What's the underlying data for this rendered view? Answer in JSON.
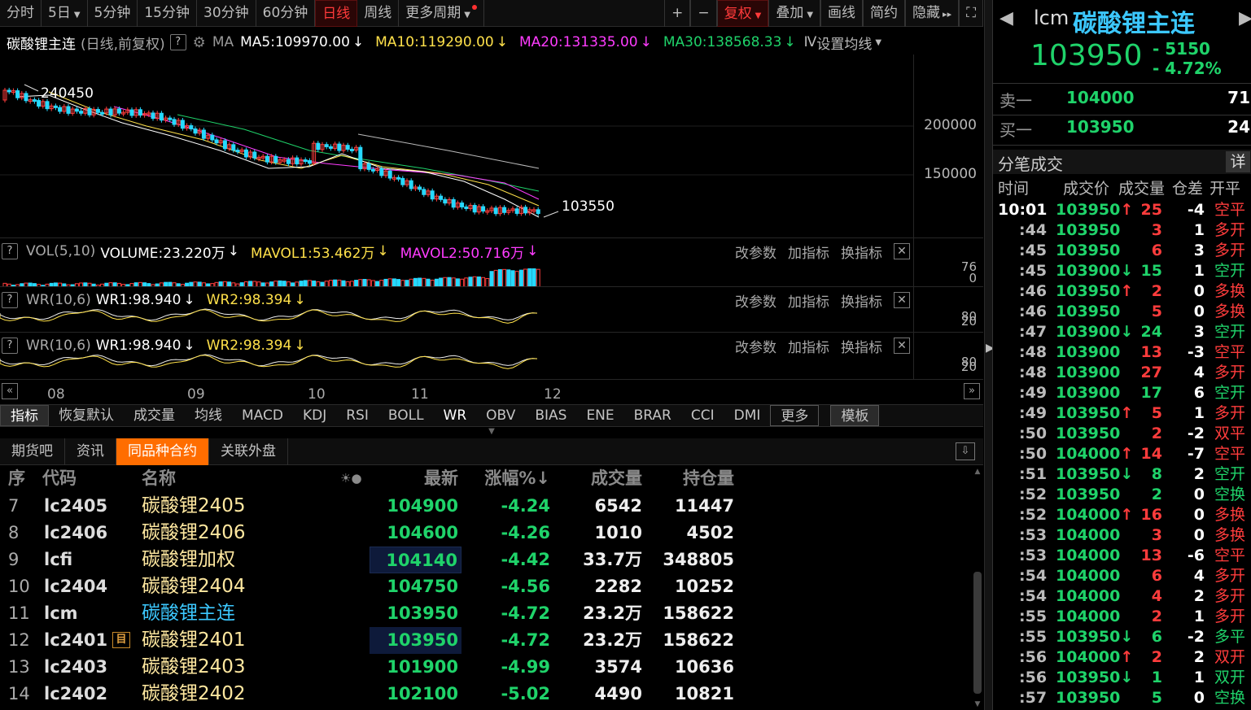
{
  "toolbar": {
    "items": [
      {
        "label": "分时",
        "active": false
      },
      {
        "label": "5日",
        "dd": true
      },
      {
        "label": "5分钟"
      },
      {
        "label": "15分钟"
      },
      {
        "label": "30分钟"
      },
      {
        "label": "60分钟"
      },
      {
        "label": "日线",
        "active": true
      },
      {
        "label": "周线"
      },
      {
        "label": "更多周期",
        "dd": true,
        "dot": true
      }
    ],
    "right": [
      {
        "label": "+"
      },
      {
        "label": "−"
      },
      {
        "label": "复权",
        "dd": true,
        "active": true
      },
      {
        "label": "叠加",
        "dd": true
      },
      {
        "label": "画线"
      },
      {
        "label": "简约"
      },
      {
        "label": "隐藏",
        "arrow": "▸▸"
      },
      {
        "label": "⛶"
      }
    ]
  },
  "ma_info": {
    "name": "碳酸锂主连",
    "mode": "(日线,前复权)",
    "q": "?",
    "ma": "MA",
    "ma5": "MA5:109970.00",
    "ma10": "MA10:119290.00",
    "ma20": "MA20:131335.00",
    "ma30": "MA30:138568.33",
    "ma_more": "Ⅳ",
    "set": "设置均线",
    "arrow": "↓"
  },
  "colors": {
    "up": "#ff3c3c",
    "down": "#26d9ff",
    "ma5": "#ffffff",
    "ma10": "#ffe14a",
    "ma20": "#ff3cff",
    "ma30": "#1fd36a",
    "bg": "#000000",
    "accent": "#ff6d00"
  },
  "main_chart": {
    "high_label": "240450",
    "low_label": "103550",
    "y_ticks": [
      "200000",
      "150000"
    ],
    "x_labels": [
      "08",
      "09",
      "10",
      "11",
      "12"
    ]
  },
  "vol_panel": {
    "q": "?",
    "name": "VOL(5,10)",
    "volume": "VOLUME:23.220万",
    "mavol1": "MAVOL1:53.462万",
    "mavol2": "MAVOL2:50.716万",
    "axis": [
      "76",
      "0"
    ],
    "btn_param": "改参数",
    "btn_add": "加指标",
    "btn_switch": "换指标",
    "close": "✕"
  },
  "wr_panels": [
    {
      "q": "?",
      "name": "WR(10,6)",
      "wr1": "WR1:98.940",
      "wr2": "WR2:98.394",
      "axis": [
        "80",
        "20"
      ],
      "btn_param": "改参数",
      "btn_add": "加指标",
      "btn_switch": "换指标",
      "close": "✕"
    },
    {
      "q": "?",
      "name": "WR(10,6)",
      "wr1": "WR1:98.940",
      "wr2": "WR2:98.394",
      "axis": [
        "80",
        "20"
      ],
      "btn_param": "改参数",
      "btn_add": "加指标",
      "btn_switch": "换指标",
      "close": "✕"
    }
  ],
  "indicator_tabs": [
    "指标",
    "恢复默认",
    "成交量",
    "均线",
    "MACD",
    "KDJ",
    "RSI",
    "BOLL",
    "WR",
    "OBV",
    "BIAS",
    "ENE",
    "BRAR",
    "CCI",
    "DMI",
    "更多",
    "模板"
  ],
  "bottom_tabs": [
    "期货吧",
    "资讯",
    "同品种合约",
    "关联外盘"
  ],
  "table": {
    "headers": {
      "seq": "序",
      "code": "代码",
      "name": "名称",
      "latest": "最新",
      "change": "涨幅%↓",
      "volume": "成交量",
      "oi": "持仓量"
    },
    "rows": [
      {
        "seq": "7",
        "code": "lc2405",
        "name": "碳酸锂2405",
        "latest": "104900",
        "change": "-4.24",
        "volume": "6542",
        "oi": "11447"
      },
      {
        "seq": "8",
        "code": "lc2406",
        "name": "碳酸锂2406",
        "latest": "104600",
        "change": "-4.26",
        "volume": "1010",
        "oi": "4502"
      },
      {
        "seq": "9",
        "code": "lcfi",
        "name": "碳酸锂加权",
        "latest": "104140",
        "change": "-4.42",
        "volume": "33.7万",
        "oi": "348805",
        "hl": true
      },
      {
        "seq": "10",
        "code": "lc2404",
        "name": "碳酸锂2404",
        "latest": "104750",
        "change": "-4.56",
        "volume": "2282",
        "oi": "10252"
      },
      {
        "seq": "11",
        "code": "lcm",
        "name": "碳酸锂主连",
        "latest": "103950",
        "change": "-4.72",
        "volume": "23.2万",
        "oi": "158622",
        "cur": true
      },
      {
        "seq": "12",
        "code": "lc2401",
        "name": "碳酸锂2401",
        "latest": "103950",
        "change": "-4.72",
        "volume": "23.2万",
        "oi": "158622",
        "hl": true,
        "icon": "目"
      },
      {
        "seq": "13",
        "code": "lc2403",
        "name": "碳酸锂2403",
        "latest": "101900",
        "change": "-4.99",
        "volume": "3574",
        "oi": "10636"
      },
      {
        "seq": "14",
        "code": "lc2402",
        "name": "碳酸锂2402",
        "latest": "102100",
        "change": "-5.02",
        "volume": "4490",
        "oi": "10821"
      }
    ]
  },
  "right_panel": {
    "code": "lcm",
    "name": "碳酸锂主连",
    "price": "103950",
    "change": "- 5150",
    "pct": "- 4.72%",
    "sell_label": "卖一",
    "sell_price": "104000",
    "sell_vol": "71",
    "buy_label": "买一",
    "buy_price": "103950",
    "buy_vol": "24",
    "ticks_title": "分笔成交",
    "detail": "详",
    "headers": {
      "time": "时间",
      "price": "成交价",
      "vol": "成交量",
      "oi": "仓差",
      "type": "开平"
    },
    "ticks": [
      {
        "t": "10:01",
        "p": "103950",
        "a": "up",
        "v": "25",
        "vc": "red",
        "o": "-4",
        "k": "空平",
        "kc": "red"
      },
      {
        "t": ":44",
        "p": "103950",
        "a": "",
        "v": "3",
        "vc": "red",
        "o": "1",
        "k": "多开",
        "kc": "red"
      },
      {
        "t": ":45",
        "p": "103950",
        "a": "",
        "v": "6",
        "vc": "red",
        "o": "3",
        "k": "多开",
        "kc": "red"
      },
      {
        "t": ":45",
        "p": "103900",
        "a": "down",
        "v": "15",
        "vc": "green",
        "o": "1",
        "k": "空开",
        "kc": "green"
      },
      {
        "t": ":46",
        "p": "103950",
        "a": "up",
        "v": "2",
        "vc": "red",
        "o": "0",
        "k": "多换",
        "kc": "red"
      },
      {
        "t": ":46",
        "p": "103950",
        "a": "",
        "v": "5",
        "vc": "red",
        "o": "0",
        "k": "多换",
        "kc": "red"
      },
      {
        "t": ":47",
        "p": "103900",
        "a": "down",
        "v": "24",
        "vc": "green",
        "o": "3",
        "k": "空开",
        "kc": "green"
      },
      {
        "t": ":48",
        "p": "103900",
        "a": "",
        "v": "13",
        "vc": "red",
        "o": "-3",
        "k": "空平",
        "kc": "red"
      },
      {
        "t": ":48",
        "p": "103900",
        "a": "",
        "v": "27",
        "vc": "red",
        "o": "4",
        "k": "多开",
        "kc": "red"
      },
      {
        "t": ":49",
        "p": "103900",
        "a": "",
        "v": "17",
        "vc": "green",
        "o": "6",
        "k": "空开",
        "kc": "green"
      },
      {
        "t": ":49",
        "p": "103950",
        "a": "up",
        "v": "5",
        "vc": "red",
        "o": "1",
        "k": "多开",
        "kc": "red"
      },
      {
        "t": ":50",
        "p": "103950",
        "a": "",
        "v": "2",
        "vc": "red",
        "o": "-2",
        "k": "双平",
        "kc": "red"
      },
      {
        "t": ":50",
        "p": "104000",
        "a": "up",
        "v": "14",
        "vc": "red",
        "o": "-7",
        "k": "空平",
        "kc": "red"
      },
      {
        "t": ":51",
        "p": "103950",
        "a": "down",
        "v": "8",
        "vc": "green",
        "o": "2",
        "k": "空开",
        "kc": "green"
      },
      {
        "t": ":52",
        "p": "103950",
        "a": "",
        "v": "2",
        "vc": "green",
        "o": "0",
        "k": "空换",
        "kc": "green"
      },
      {
        "t": ":52",
        "p": "104000",
        "a": "up",
        "v": "16",
        "vc": "red",
        "o": "0",
        "k": "多换",
        "kc": "red"
      },
      {
        "t": ":53",
        "p": "104000",
        "a": "",
        "v": "3",
        "vc": "red",
        "o": "0",
        "k": "多换",
        "kc": "red"
      },
      {
        "t": ":53",
        "p": "104000",
        "a": "",
        "v": "13",
        "vc": "red",
        "o": "-6",
        "k": "空平",
        "kc": "red"
      },
      {
        "t": ":54",
        "p": "104000",
        "a": "",
        "v": "6",
        "vc": "red",
        "o": "4",
        "k": "多开",
        "kc": "red"
      },
      {
        "t": ":54",
        "p": "104000",
        "a": "",
        "v": "4",
        "vc": "red",
        "o": "2",
        "k": "多开",
        "kc": "red"
      },
      {
        "t": ":55",
        "p": "104000",
        "a": "",
        "v": "2",
        "vc": "red",
        "o": "1",
        "k": "多开",
        "kc": "red"
      },
      {
        "t": ":55",
        "p": "103950",
        "a": "down",
        "v": "6",
        "vc": "green",
        "o": "-2",
        "k": "多平",
        "kc": "green"
      },
      {
        "t": ":56",
        "p": "104000",
        "a": "up",
        "v": "2",
        "vc": "red",
        "o": "2",
        "k": "双开",
        "kc": "red"
      },
      {
        "t": ":56",
        "p": "103950",
        "a": "down",
        "v": "1",
        "vc": "green",
        "o": "1",
        "k": "双开",
        "kc": "green"
      },
      {
        "t": ":57",
        "p": "103950",
        "a": "",
        "v": "5",
        "vc": "green",
        "o": "0",
        "k": "空换",
        "kc": "green"
      }
    ]
  }
}
